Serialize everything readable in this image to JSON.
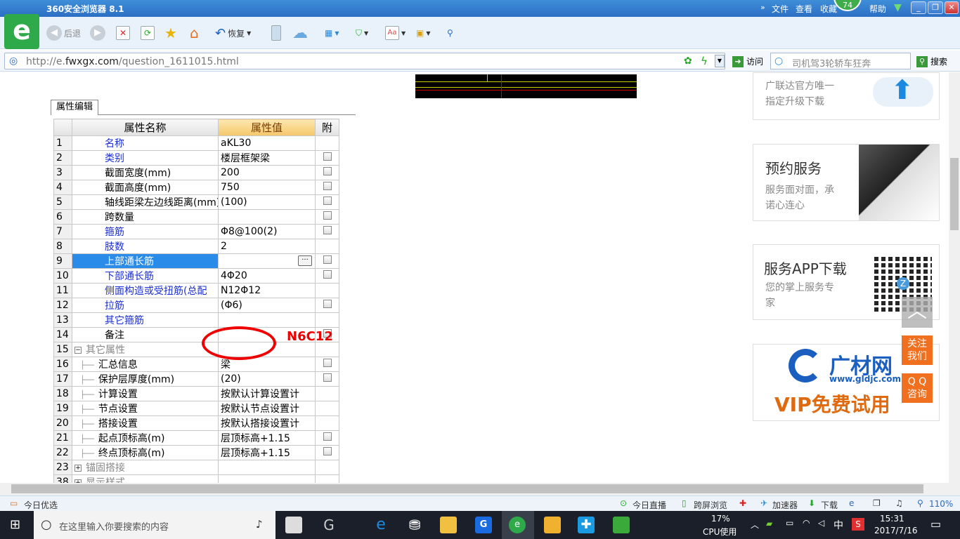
{
  "window": {
    "title": "360安全浏览器 8.1",
    "menu": [
      "文件",
      "查看",
      "收藏",
      "帮助"
    ],
    "badge": "74"
  },
  "toolbar": {
    "back": "后退",
    "restore": "恢复"
  },
  "address": {
    "url_prefix": "http://e.",
    "url_domain": "fwxgx.com",
    "url_path": "/question_1611015.html",
    "go": "访问",
    "search_placeholder": "司机驾3轮轿车狂奔",
    "search_btn": "搜索"
  },
  "panel": {
    "tab": "属性编辑",
    "headers": {
      "name": "属性名称",
      "value": "属性值",
      "attach": "附"
    },
    "rows": [
      {
        "no": "1",
        "name": "名称",
        "value": "aKL30",
        "style": "blue",
        "check": false
      },
      {
        "no": "2",
        "name": "类别",
        "value": "楼层框架梁",
        "style": "blue",
        "check": true
      },
      {
        "no": "3",
        "name": "截面宽度(mm)",
        "value": "200",
        "style": "",
        "check": true
      },
      {
        "no": "4",
        "name": "截面高度(mm)",
        "value": "750",
        "style": "",
        "check": true
      },
      {
        "no": "5",
        "name": "轴线距梁左边线距离(mm)",
        "value": "(100)",
        "style": "",
        "check": true
      },
      {
        "no": "6",
        "name": "跨数量",
        "value": "",
        "style": "",
        "check": true
      },
      {
        "no": "7",
        "name": "箍筋",
        "value": "Φ8@100(2)",
        "style": "blue",
        "check": true
      },
      {
        "no": "8",
        "name": "肢数",
        "value": "2",
        "style": "blue",
        "check": false
      },
      {
        "no": "9",
        "name": "上部通长筋",
        "value": "",
        "style": "sel",
        "check": true
      },
      {
        "no": "10",
        "name": "下部通长筋",
        "value": "4Φ20",
        "style": "blue",
        "check": true
      },
      {
        "no": "11",
        "name": "侧面构造或受扭筋(总配",
        "value": "N12Φ12",
        "style": "blue",
        "check": false
      },
      {
        "no": "12",
        "name": "拉筋",
        "value": "(Φ6)",
        "style": "blue",
        "check": true
      },
      {
        "no": "13",
        "name": "其它箍筋",
        "value": "",
        "style": "blue",
        "check": false
      },
      {
        "no": "14",
        "name": "备注",
        "value": "",
        "style": "",
        "check": true
      },
      {
        "no": "15",
        "name": "其它属性",
        "value": "",
        "style": "group",
        "check": false
      },
      {
        "no": "16",
        "name": "汇总信息",
        "value": "梁",
        "style": "child",
        "check": true
      },
      {
        "no": "17",
        "name": "保护层厚度(mm)",
        "value": "(20)",
        "style": "child",
        "check": true
      },
      {
        "no": "18",
        "name": "计算设置",
        "value": "按默认计算设置计",
        "style": "child",
        "check": false
      },
      {
        "no": "19",
        "name": "节点设置",
        "value": "按默认节点设置计",
        "style": "child",
        "check": false
      },
      {
        "no": "20",
        "name": "搭接设置",
        "value": "按默认搭接设置计",
        "style": "child",
        "check": false
      },
      {
        "no": "21",
        "name": "起点顶标高(m)",
        "value": "层顶标高+1.15",
        "style": "child",
        "check": true
      },
      {
        "no": "22",
        "name": "终点顶标高(m)",
        "value": "层顶标高+1.15",
        "style": "child",
        "check": true
      },
      {
        "no": "23",
        "name": "锚固搭接",
        "value": "",
        "style": "group2",
        "check": false
      },
      {
        "no": "38",
        "name": "显示样式",
        "value": "",
        "style": "group2",
        "check": false
      }
    ],
    "annotation": "N6C12"
  },
  "ads": {
    "upgrade": {
      "line1": "广联达官方唯一",
      "line2": "指定升级下载"
    },
    "service": {
      "title": "预约服务",
      "line1": "服务面对面，承",
      "line2": "诺心连心"
    },
    "app": {
      "title": "服务APP下载",
      "line1": "您的掌上服务专",
      "line2": "家"
    },
    "gldjc": {
      "brand": "广材网",
      "url": "www.gldjc.com",
      "vip": "VIP免费试用"
    }
  },
  "float": {
    "follow1": "关注",
    "follow2": "我们",
    "qq1": "Q Q",
    "qq2": "咨询"
  },
  "status": {
    "left": "今日优选",
    "live": "今日直播",
    "cross": "跨屏浏览",
    "accel": "加速器",
    "download": "下载",
    "zoom": "110%"
  },
  "taskbar": {
    "search": "在这里输入你要搜索的内容",
    "cpu_pct": "17%",
    "cpu_label": "CPU使用",
    "ime": "中",
    "time": "15:31",
    "date": "2017/7/16"
  },
  "colors": {
    "accent": "#2c6fc4",
    "highlight": "#e00000",
    "selection": "#2a8ce8"
  }
}
